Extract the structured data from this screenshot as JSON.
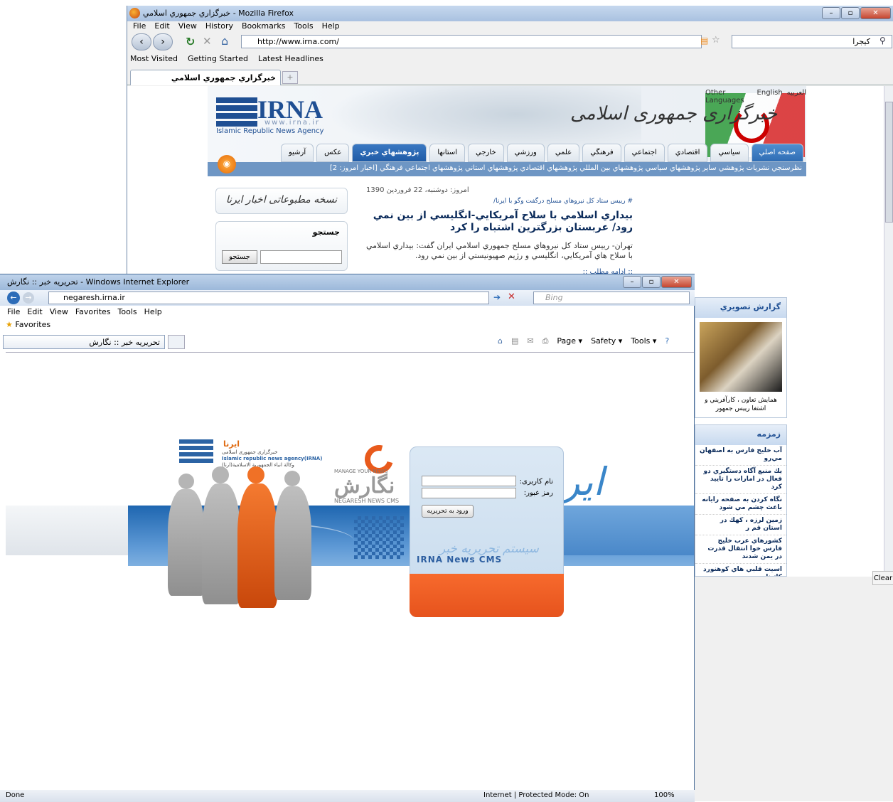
{
  "firefox": {
    "title": "خبرگزاري جمهوري اسلامي - Mozilla Firefox",
    "menu": [
      "File",
      "Edit",
      "View",
      "History",
      "Bookmarks",
      "Tools",
      "Help"
    ],
    "url": "http://www.irna.com/",
    "search_engine_text": "كيجرا",
    "bookmarks": [
      "Most Visited",
      "Getting Started",
      "Latest Headlines"
    ],
    "tab_title": "خبرگزاري جمهوري اسلامي",
    "clear_label": "Clear"
  },
  "irna": {
    "logo_text": "IRNA",
    "logo_url": "www.irna.ir",
    "logo_sub": "Islamic Republic News Agency",
    "persian_title": "خبرگزاری جمهوری اسلامی",
    "languages": [
      "Other Languages",
      "English",
      "العربيه"
    ],
    "nav_tabs": [
      "صفحه اصلي",
      "سياسي",
      "اقتصادي",
      "اجتماعي",
      "فرهنگي",
      "علمي",
      "ورزشي",
      "خارجي",
      "استانها",
      "پژوهشهاي خبري",
      "عكس",
      "آرشيو"
    ],
    "subnav": "نظرسنجي   نشريات پژوهشي   ساير   پژوهشهاي سياسي   پژوهشهاي بين المللي   پژوهشهاي اقتصادي   پژوهشهاي استاني   پژوهشهاي اجتماعي فرهنگي   [اخبار امروز: 2]",
    "printed_edition": "نسخه مطبوعاتی اخبار ایرنا",
    "search_heading": "جستجو",
    "search_button": "جستجو",
    "date": "امروز: دوشنبه، 22 فروردين 1390",
    "kicker": "# رييس ستاد كل نيروهاي مسلح درگفت وگو با ايرنا/",
    "headline": "بيداري اسلامي با سلاح آمريكايي-انگليسي از بين نمي رود/ عربستان بزرگترين اشتباه را كرد",
    "lead": "تهران- رييس ستاد كل نيروهاي مسلح جمهوري اسلامي ايران گفت: بيداري اسلامي با سلاح هاي آمريكايي، انگليسي و رژيم صهيونيستي از بين نمي رود.",
    "more": ":: ادامه مطلب ::",
    "photo_panel_title": "گزارش تصويري",
    "photo_caption": "همايش تعاون ، كارآفريني و اشتغا رييس جمهور",
    "zamzameh_title": "زمزمه",
    "zamzameh_items": [
      "آب خليج فارس به اصفهان مي‌رو",
      "يك منبع آگاه دستگيري دو فعال در امارات را تاييد كرد",
      "نگاه كردن به صفحه رايانه باعث چشم مي شود",
      "زمين لرزه ، كهك در استان قم ر",
      "كشورهاي عرب خليج فارس خوا انتقال قدرت در يمن شدند",
      "اسيت قلبي هاي كوهنورد كاتيناي"
    ]
  },
  "ie": {
    "title": "تحريريه خبر :: نگارش - Windows Internet Explorer",
    "url": "negaresh.irna.ir",
    "search_placeholder": "Bing",
    "menu": [
      "File",
      "Edit",
      "View",
      "Favorites",
      "Tools",
      "Help"
    ],
    "favorites": "Favorites",
    "tab_title": "تحريريه خبر :: نگارش",
    "commands": [
      "Page ▾",
      "Safety ▾",
      "Tools ▾"
    ],
    "status_left": "Done",
    "status_zone": "Internet | Protected Mode: On",
    "zoom": "100%"
  },
  "cms": {
    "logo_ar": "ايرنا",
    "logo_lines": [
      "خبرگزاری جمهوری اسلامی",
      "Islamic republic news agency(IRNA)",
      "وكالة انباء الجمهورية الاسلامية(ارنا)"
    ],
    "manage": "MANAGE YOUR NEWS",
    "negaresh_fa": "نگارش",
    "negaresh_en": "NEGARESH NEWS CMS",
    "calligraphy": "ایرنا",
    "username_label": "نام کاربری:",
    "password_label": "رمز عبور:",
    "login_button": "ورود به تحريريه",
    "system_fa": "سیستم تحریریه خبر",
    "system_en": "IRNA News CMS"
  }
}
